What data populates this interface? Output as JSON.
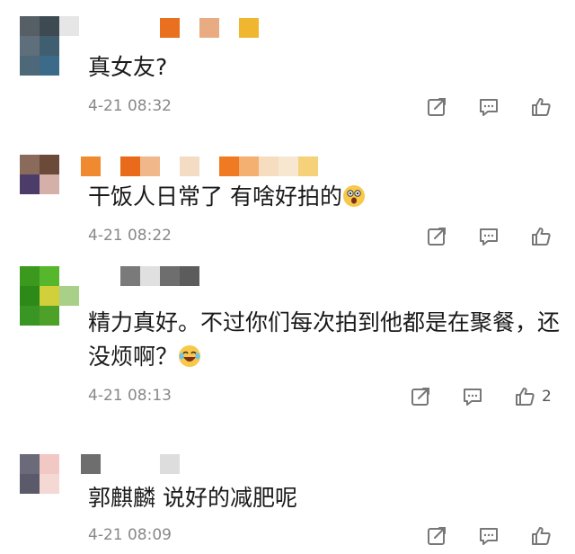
{
  "comments": [
    {
      "text": "真女友?",
      "time": "4-21 08:32",
      "likes": "",
      "avatar_colors": [
        "#565e66",
        "#3e4a52",
        "#e6e6e6",
        "#5e6e7a",
        "#3f5e70",
        "#ffffff",
        "#4d6878",
        "#3b6b88",
        "#ffffff"
      ],
      "name_colors": [
        "#ffffff",
        "#e8701e",
        "#ffffff",
        "#e8ab82",
        "#ffffff",
        "#f0b630"
      ]
    },
    {
      "text": "干饭人日常了 有啥好拍的",
      "emoji": "shocked-face-emoji",
      "time": "4-21 08:22",
      "likes": "",
      "avatar_colors": [
        "#8a6a5a",
        "#6c4a3a",
        "#ffffff",
        "#4c3c6a",
        "#d4b0a8",
        "#ffffff",
        "#ffffff",
        "#ffffff",
        "#ffffff"
      ],
      "name_colors": [
        "#ef8a30",
        "#ffffff",
        "#e86a1a",
        "#f0b88a",
        "#ffffff",
        "#f4dcc4",
        "#ffffff",
        "#ef7a22",
        "#f3b070",
        "#f6ddc0",
        "#f7e7d0",
        "#f5d27a"
      ]
    },
    {
      "text": "精力真好。不过你们每次拍到他都是在聚餐，还没烦啊？",
      "emoji": "laughing-tears-emoji",
      "time": "4-21 08:13",
      "likes": "2",
      "avatar_colors": [
        "#3b9a1e",
        "#56b62c",
        "#ffffff",
        "#2d8a18",
        "#d2d03a",
        "#a8d088",
        "#3a9624",
        "#4da028",
        "#ffffff"
      ],
      "name_colors": [
        "#7a7a7a",
        "#e0e0e0",
        "#6e6e6e",
        "#5c5c5c"
      ]
    },
    {
      "text": "郭麒麟 说好的减肥呢",
      "time": "4-21 08:09",
      "likes": "",
      "avatar_colors": [
        "#6a6a7a",
        "#f2c8c4",
        "#ffffff",
        "#5a5a6a",
        "#f4d8d4",
        "#ffffff",
        "#ffffff",
        "#ffffff",
        "#ffffff"
      ],
      "name_colors": [
        "#6e6e6e",
        "#ffffff",
        "#ffffff",
        "#ffffff",
        "#dddddd"
      ]
    }
  ],
  "icons": {
    "share": "share-icon",
    "reply": "reply-icon",
    "like": "like-icon"
  }
}
